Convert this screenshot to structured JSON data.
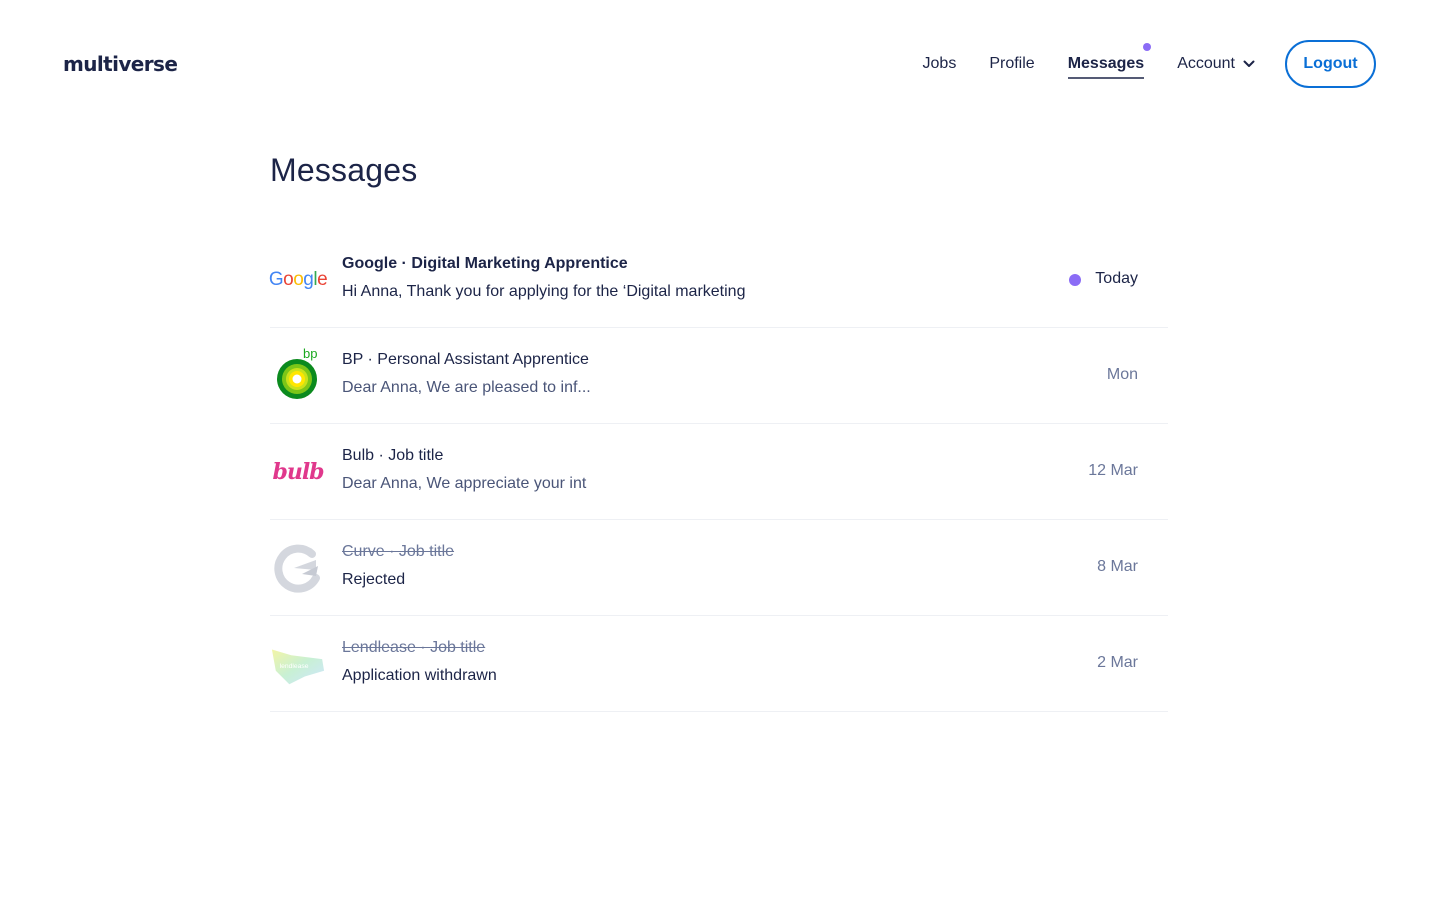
{
  "app": {
    "logo_text": "multiverse"
  },
  "nav": {
    "jobs": "Jobs",
    "profile": "Profile",
    "messages": "Messages",
    "account": "Account",
    "logout": "Logout",
    "accent_dot_color": "#8b6cf6",
    "logout_color": "#0a6fd6"
  },
  "page": {
    "title": "Messages"
  },
  "messages": [
    {
      "logo": "google-logo",
      "logo_text": "Google",
      "title": "Google · Digital Marketing Apprentice",
      "preview": "Hi Anna, Thank you for applying for the ‘Digital marketing",
      "date": "Today",
      "unread": true
    },
    {
      "logo": "bp-logo",
      "logo_text": "bp",
      "title": "BP · Personal Assistant Apprentice",
      "preview": "Dear Anna, We are pleased to inf...",
      "date": "Mon",
      "unread": false
    },
    {
      "logo": "bulb-logo",
      "logo_text": "bulb",
      "title": "Bulb · Job title",
      "preview": "Dear Anna, We appreciate your int",
      "date": "12 Mar",
      "unread": false
    },
    {
      "logo": "curve-logo",
      "title": "Curve · Job title",
      "preview": "Rejected",
      "date": "8 Mar",
      "unread": false,
      "closed": true
    },
    {
      "logo": "lendlease-logo",
      "logo_text": "lendlease",
      "title": "Lendlease · Job title",
      "preview": "Application withdrawn",
      "date": "2 Mar",
      "unread": false,
      "closed": true
    }
  ]
}
